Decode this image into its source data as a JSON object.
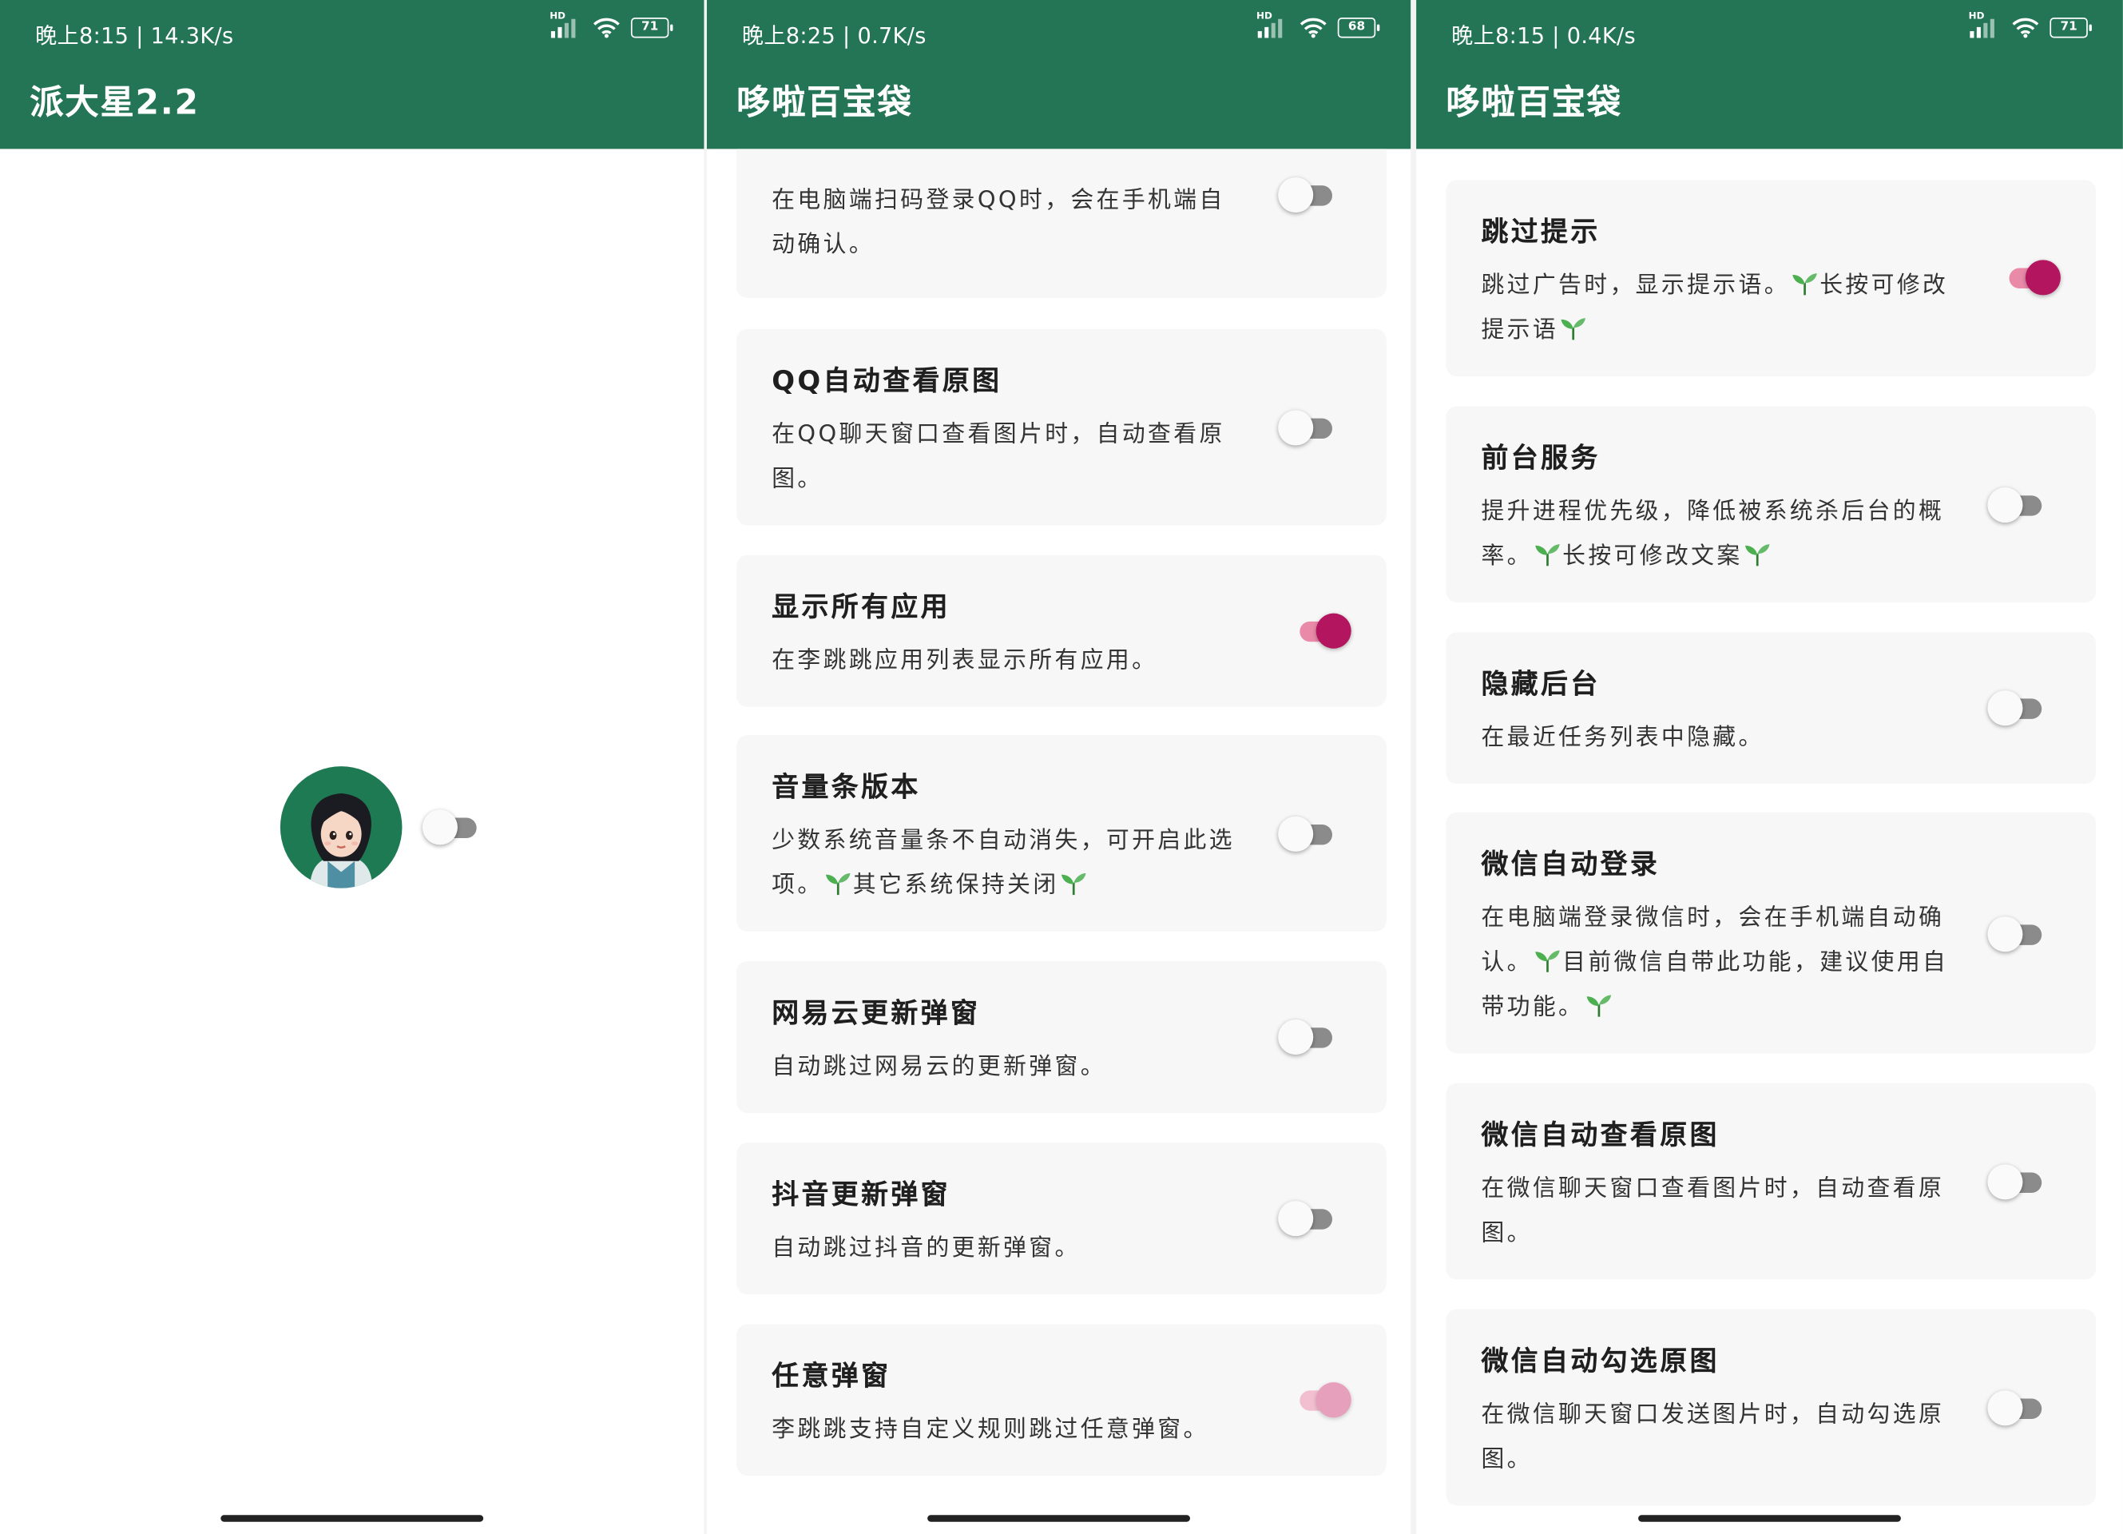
{
  "colors": {
    "appbar": "#237556",
    "switch_on_track": "#e98aa9",
    "switch_on_thumb": "#b3155e",
    "switch_off_track": "#8b8b8b",
    "card_bg": "#f7f7f7"
  },
  "screens": [
    {
      "status": {
        "time_speed": "晚上8:15 | 14.3K/s",
        "battery": "71"
      },
      "title": "派大星2.2",
      "switch_on": false
    },
    {
      "status": {
        "time_speed": "晚上8:25 | 0.7K/s",
        "battery": "68"
      },
      "title": "哆啦百宝袋",
      "items": [
        {
          "desc": "在电脑端扫码登录QQ时，会在手机端自动确认。",
          "on": false
        },
        {
          "title": "QQ自动查看原图",
          "desc": "在QQ聊天窗口查看图片时，自动查看原图。",
          "on": false
        },
        {
          "title": "显示所有应用",
          "desc": "在李跳跳应用列表显示所有应用。",
          "on": true
        },
        {
          "title": "音量条版本",
          "desc": "少数系统音量条不自动消失，可开启此选项。",
          "desc_extra": "其它系统保持关闭",
          "on": false
        },
        {
          "title": "网易云更新弹窗",
          "desc": "自动跳过网易云的更新弹窗。",
          "on": false
        },
        {
          "title": "抖音更新弹窗",
          "desc": "自动跳过抖音的更新弹窗。",
          "on": false
        },
        {
          "title": "任意弹窗",
          "desc": "李跳跳支持自定义规则跳过任意弹窗。",
          "on": true
        }
      ]
    },
    {
      "status": {
        "time_speed": "晚上8:15 | 0.4K/s",
        "battery": "71"
      },
      "title": "哆啦百宝袋",
      "items": [
        {
          "title": "跳过提示",
          "desc": "跳过广告时，显示提示语。",
          "desc_extra": "长按可修改提示语",
          "on": true
        },
        {
          "title": "前台服务",
          "desc": "提升进程优先级，降低被系统杀后台的概率。",
          "desc_extra": "长按可修改文案",
          "on": false
        },
        {
          "title": "隐藏后台",
          "desc": "在最近任务列表中隐藏。",
          "on": false
        },
        {
          "title": "微信自动登录",
          "desc": "在电脑端登录微信时，会在手机端自动确认。",
          "desc_extra": "目前微信自带此功能，建议使用自带功能。",
          "on": false
        },
        {
          "title": "微信自动查看原图",
          "desc": "在微信聊天窗口查看图片时，自动查看原图。",
          "on": false
        },
        {
          "title": "微信自动勾选原图",
          "desc": "在微信聊天窗口发送图片时，自动勾选原图。",
          "on": false
        }
      ]
    }
  ]
}
